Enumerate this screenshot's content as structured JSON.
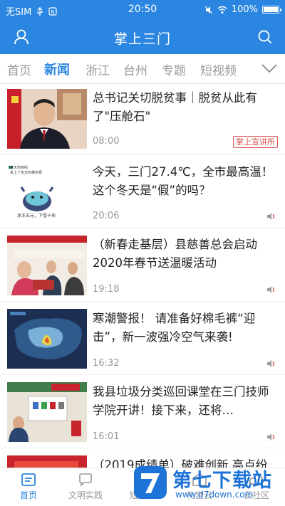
{
  "status": {
    "carrier": "无SIM",
    "time": "20:50",
    "battery": "100%"
  },
  "app": {
    "title": "掌上三门"
  },
  "tabs": [
    "首页",
    "新闻",
    "浙江",
    "台州",
    "专题",
    "短视频"
  ],
  "news": [
    {
      "title": "总书记关切脱贫事｜脱贫从此有了\"压舱石\"",
      "time": "08:00",
      "tag": "掌上宣讲所",
      "audio": false
    },
    {
      "title": "今天，三门27.4℃，全市最高温！这个冬天是“假”的吗？",
      "time": "20:06",
      "audio": true,
      "thumb_text": {
        "line1": "今天你热吗",
        "line2": "关上了冬天的棉衣柜",
        "line3": "冰冻五元，下雪十块"
      }
    },
    {
      "title": "（新春走基层）县慈善总会启动2020年春节送温暖活动",
      "time": "19:18",
      "audio": true
    },
    {
      "title": "寒潮警报！ 请准备好棉毛裤“迎击”，新一波强冷空气来袭!",
      "time": "16:32",
      "audio": true
    },
    {
      "title": "我县垃圾分类巡回课堂在三门技师学院开讲！接下来，还将…",
      "time": "16:01",
      "audio": true
    },
    {
      "title": "（2019成绩单）破难创新 高点纷",
      "time": "",
      "audio": false
    }
  ],
  "bottom_nav": [
    {
      "label": "首页"
    },
    {
      "label": "文明实践"
    },
    {
      "label": "短视频"
    },
    {
      "label": "礼堂云"
    },
    {
      "label": "云社区"
    }
  ],
  "watermark": {
    "brand": "第七下载站",
    "url": "www.d7down.com"
  },
  "colors": {
    "brand_blue": "#2a86e0",
    "tag_red": "#d9534f"
  }
}
